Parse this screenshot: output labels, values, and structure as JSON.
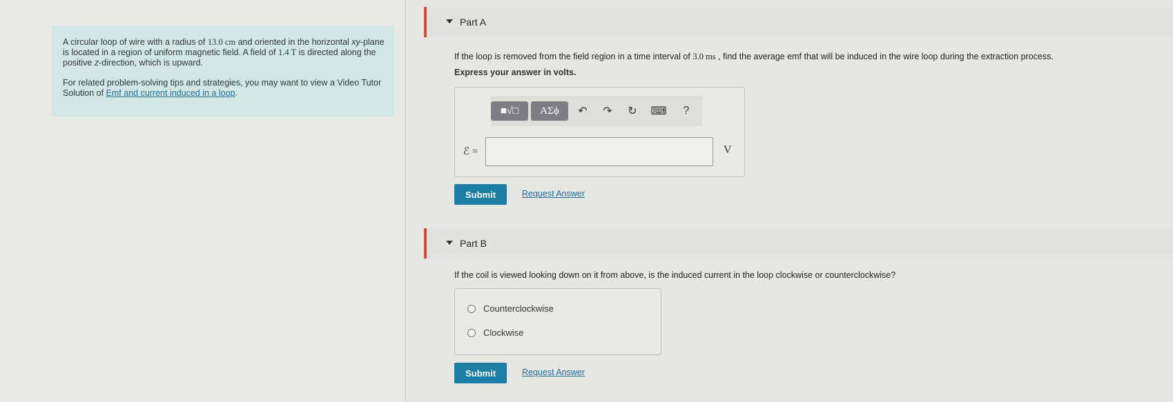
{
  "intro": {
    "p1_a": "A circular loop of wire with a radius of ",
    "p1_radius": "13.0 cm",
    "p1_b": " and oriented in the horizontal ",
    "p1_plane": "xy",
    "p1_c": "-plane is located in a region of uniform magnetic field. A field of ",
    "p1_field": "1.4 T",
    "p1_d": " is directed along the positive ",
    "p1_dir": "z",
    "p1_e": "-direction, which is upward.",
    "p2_a": "For related problem-solving tips and strategies, you may want to view a Video Tutor Solution of ",
    "p2_link": "Emf and current induced in a loop",
    "p2_b": "."
  },
  "partA": {
    "title": "Part A",
    "question_a": "If the loop is removed from the field region in a time interval of ",
    "question_time": "3.0 ms",
    "question_b": " , find the average emf that will be induced in the wire loop during the extraction process.",
    "express": "Express your answer in volts.",
    "toolbar": {
      "templates_label": "■√□",
      "greek_label": "AΣϕ",
      "undo_icon": "↶",
      "redo_icon": "↷",
      "reset_icon": "↻",
      "keyboard_icon": "⌨",
      "help_label": "?"
    },
    "variable_label": "ℰ =",
    "input_value": "",
    "unit": "V",
    "submit_label": "Submit",
    "request_label": "Request Answer"
  },
  "partB": {
    "title": "Part B",
    "question": "If the coil is viewed looking down on it from above, is the induced current in the loop clockwise or counterclockwise?",
    "options": [
      "Counterclockwise",
      "Clockwise"
    ],
    "submit_label": "Submit",
    "request_label": "Request Answer"
  },
  "colors": {
    "accent_bar": "#d9492e",
    "submit_bg": "#1a7ea5",
    "link": "#1e6f9a",
    "intro_bg": "#d2e6e4"
  }
}
